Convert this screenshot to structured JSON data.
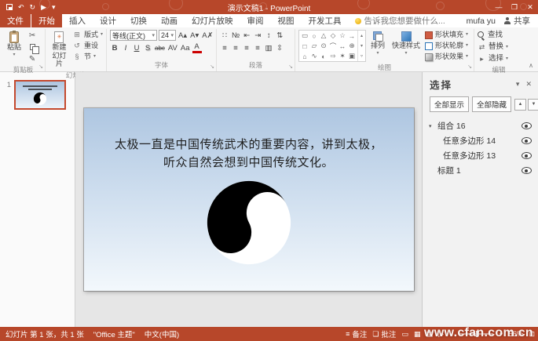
{
  "titlebar": {
    "title": "演示文稿1 - PowerPoint"
  },
  "tabs": {
    "file": "文件",
    "home": "开始",
    "insert": "插入",
    "design": "设计",
    "transitions": "切换",
    "animations": "动画",
    "slideshow": "幻灯片放映",
    "review": "审阅",
    "view": "视图",
    "developer": "开发工具",
    "tellme": "告诉我您想要做什么...",
    "user": "mufa yu",
    "share": "共享"
  },
  "ribbon": {
    "clipboard": {
      "label": "剪贴板",
      "paste": "粘贴"
    },
    "slides": {
      "label": "幻灯片",
      "new_slide_line1": "新建",
      "new_slide_line2": "幻灯片",
      "layout": "版式",
      "reset": "重设",
      "section": "节"
    },
    "font": {
      "label": "字体",
      "name": "等线(正文)",
      "size": "24"
    },
    "paragraph": {
      "label": "段落"
    },
    "drawing": {
      "label": "绘图",
      "arrange": "排列",
      "quick_styles": "快速样式",
      "fill": "形状填充",
      "outline": "形状轮廓",
      "effects": "形状效果"
    },
    "editing": {
      "label": "编辑",
      "find": "查找",
      "replace": "替换",
      "select": "选择"
    }
  },
  "thumbnails": {
    "slide_number": "1"
  },
  "slide": {
    "line1": "太极一直是中国传统武术的重要内容，讲到太极，",
    "line2": "听众自然会想到中国传统文化。"
  },
  "selection_pane": {
    "title": "选择",
    "show_all": "全部显示",
    "hide_all": "全部隐藏",
    "items": [
      {
        "label": "组合 16"
      },
      {
        "label": "任意多边形 14"
      },
      {
        "label": "任意多边形 13"
      },
      {
        "label": "标题 1"
      }
    ]
  },
  "status": {
    "slide_info": "幻灯片 第 1 张，共 1 张",
    "theme": "\"Office 主题\"",
    "language": "中文(中国)",
    "notes": "备注",
    "comments": "批注",
    "zoom": "56%"
  },
  "watermark": "www.cfan.com.cn",
  "colors": {
    "accent": "#B7472A",
    "slide_gradient_top": "#AEC6E1",
    "slide_gradient_bottom": "#F3F8FC",
    "selected_thumb_border": "#C4492E"
  },
  "icons": {
    "undo": "↶",
    "redo": "↻",
    "slideshow_qat": "▶",
    "qat_more": "▾",
    "win_min": "—",
    "win_restore": "❐",
    "win_close": "✕",
    "ribbon_collapse": "∧",
    "dropdown": "▾",
    "dialog_launcher": "↘",
    "scissors": "✂",
    "format_painter": "✎",
    "layout": "⊞",
    "reset": "↺",
    "section": "§",
    "grow_font": "A▴",
    "shrink_font": "A▾",
    "clear_format": "A✗",
    "bold": "B",
    "italic": "I",
    "underline": "U",
    "shadow": "S",
    "strike": "abc",
    "spacing": "AV",
    "case": "Aa",
    "font_color": "A",
    "bullets": "∷",
    "numbering": "№",
    "outdent": "⇤",
    "indent": "⇥",
    "line_spacing": "↕",
    "text_dir": "⇅",
    "align_left": "≡",
    "align_center": "≡",
    "align_right": "≡",
    "justify": "≡",
    "columns": "▥",
    "align_text": "⇳",
    "shapes": [
      "▭",
      "○",
      "△",
      "◇",
      "☆",
      "→",
      "□",
      "▱",
      "⊙",
      "⌒",
      "↔",
      "⊕",
      "⌂",
      "∿",
      "◐",
      "⇨",
      "✶",
      "▣"
    ],
    "gal_up": "▴",
    "gal_down": "▾",
    "gal_more": "▿",
    "replace": "⇄",
    "select": "▸",
    "star": "✳",
    "expander": "▾",
    "pane_menu": "▾",
    "pane_close": "✕",
    "reorder_up": "▲",
    "reorder_down": "▼",
    "notes": "≡",
    "comments": "❏",
    "view_normal": "▭",
    "view_sorter": "▦",
    "view_reading": "▤",
    "view_show": "▷",
    "zoom_out": "−",
    "zoom_in": "+",
    "fit": "⊡"
  }
}
